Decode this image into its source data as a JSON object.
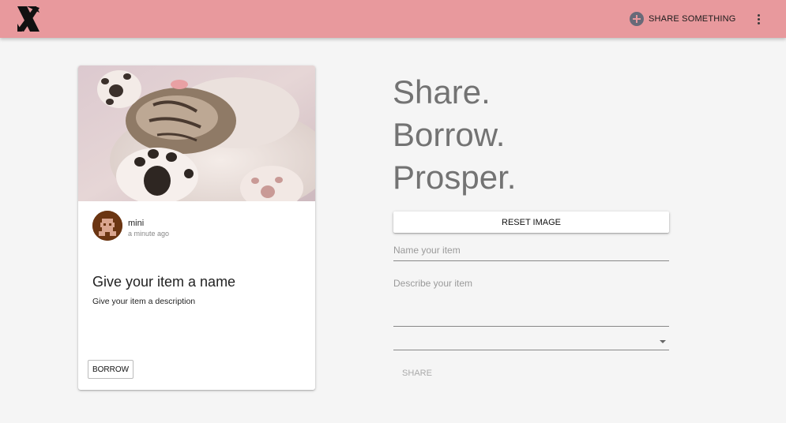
{
  "header": {
    "logo_icon": "boomtown-logo-icon",
    "share_icon": "add-circle-icon",
    "share_label": "SHARE SOMETHING",
    "menu_icon": "more-vert-icon",
    "background_color": "#e8999d"
  },
  "card": {
    "image_icon": "kitten-photo",
    "owner": {
      "name": "mini",
      "time": "a minute ago",
      "avatar_icon": "pixel-avatar-icon"
    },
    "title": "Give your item a name",
    "description": "Give your item a description",
    "borrow_label": "BORROW"
  },
  "form": {
    "headline": [
      "Share.",
      "Borrow.",
      "Prosper."
    ],
    "reset_label": "RESET IMAGE",
    "name_placeholder": "Name your item",
    "description_placeholder": "Describe your item",
    "select_value": "",
    "submit_label": "SHARE"
  }
}
